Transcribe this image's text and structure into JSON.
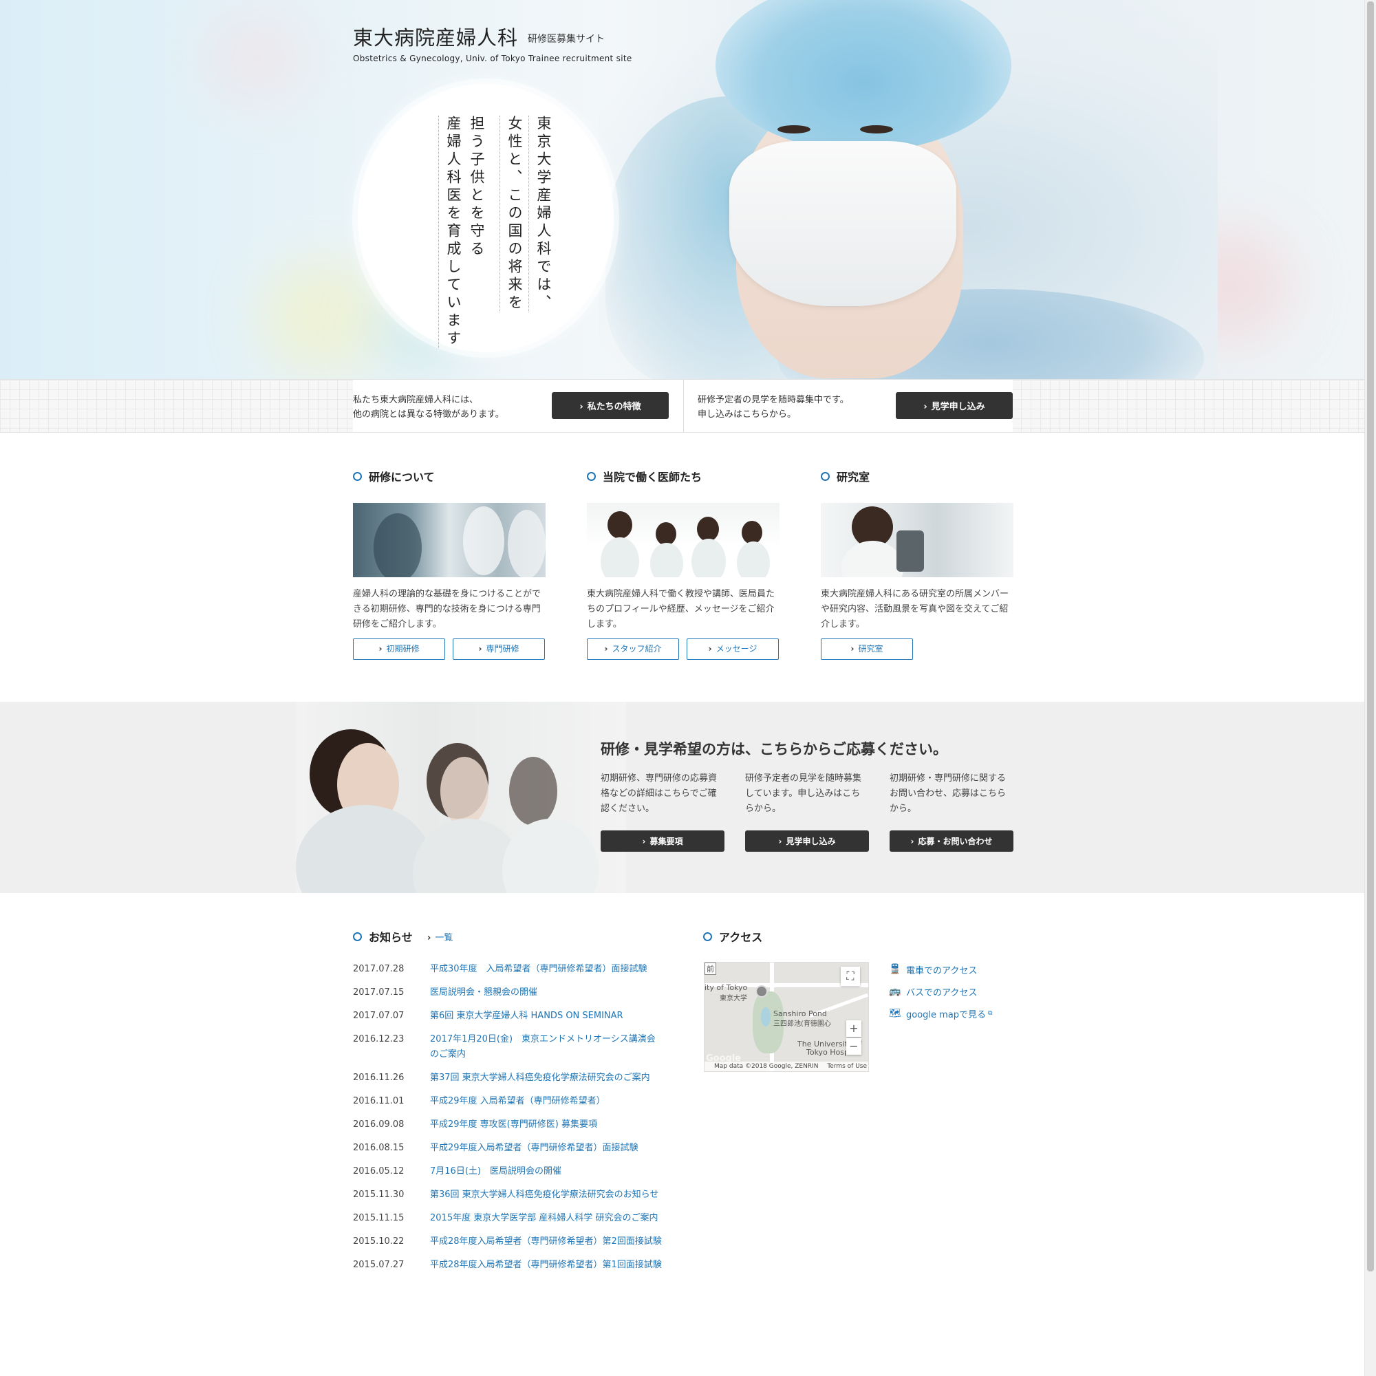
{
  "header": {
    "logo_ja": "東大病院産婦人科",
    "logo_sub": "研修医募集サイト",
    "logo_en": "Obstetrics & Gynecology, Univ. of Tokyo Trainee recruitment site"
  },
  "hero": {
    "lines": [
      "東京大学産婦人科では、",
      "女性と、この国の将来を",
      "担う子供とを守る",
      "産婦人科医を育成しています"
    ]
  },
  "strip": {
    "left_text_1": "私たち東大病院産婦人科には、",
    "left_text_2": "他の病院とは異なる特徴があります。",
    "left_button": "私たちの特徴",
    "right_text_1": "研修予定者の見学を随時募集中です。",
    "right_text_2": "申し込みはこちらから。",
    "right_button": "見学申し込み"
  },
  "features": [
    {
      "title": "研修について",
      "desc": "産婦人科の理論的な基礎を身につけることができる初期研修、専門的な技術を身につける専門研修をご紹介します。",
      "buttons": [
        "初期研修",
        "専門研修"
      ]
    },
    {
      "title": "当院で働く医師たち",
      "desc": "東大病院産婦人科で働く教授や講師、医局員たちのプロフィールや経歴、メッセージをご紹介します。",
      "buttons": [
        "スタッフ紹介",
        "メッセージ"
      ]
    },
    {
      "title": "研究室",
      "desc": "東大病院産婦人科にある研究室の所属メンバーや研究内容、活動風景を写真や図を交えてご紹介します。",
      "buttons": [
        "研究室"
      ]
    }
  ],
  "apply": {
    "heading": "研修・見学希望の方は、こちらからご応募ください。",
    "columns": [
      {
        "text": "初期研修、専門研修の応募資格などの詳細はこちらでご確認ください。",
        "button": "募集要項"
      },
      {
        "text": "研修予定者の見学を随時募集しています。申し込みはこちらから。",
        "button": "見学申し込み"
      },
      {
        "text": "初期研修・専門研修に関するお問い合わせ、応募はこちらから。",
        "button": "応募・お問い合わせ"
      }
    ]
  },
  "news": {
    "title": "お知らせ",
    "all_link": "一覧",
    "items": [
      {
        "date": "2017.07.28",
        "title": "平成30年度　入局希望者（専門研修希望者）面接試験"
      },
      {
        "date": "2017.07.15",
        "title": "医局説明会・懇親会の開催"
      },
      {
        "date": "2017.07.07",
        "title": "第6回 東京大学産婦人科 HANDS ON SEMINAR"
      },
      {
        "date": "2016.12.23",
        "title": "2017年1月20日(金)　東京エンドメトリオーシス講演会のご案内"
      },
      {
        "date": "2016.11.26",
        "title": "第37回 東京大学婦人科癌免疫化学療法研究会のご案内"
      },
      {
        "date": "2016.11.01",
        "title": "平成29年度 入局希望者（専門研修希望者）"
      },
      {
        "date": "2016.09.08",
        "title": "平成29年度 専攻医(専門研修医) 募集要項"
      },
      {
        "date": "2016.08.15",
        "title": "平成29年度入局希望者（専門研修希望者）面接試験"
      },
      {
        "date": "2016.05.12",
        "title": "7月16日(土)　医局説明会の開催"
      },
      {
        "date": "2015.11.30",
        "title": "第36回 東京大学婦人科癌免疫化学療法研究会のお知らせ"
      },
      {
        "date": "2015.11.15",
        "title": "2015年度 東京大学医学部 産科婦人科学 研究会のご案内"
      },
      {
        "date": "2015.10.22",
        "title": "平成28年度入局希望者（専門研修希望者）第2回面接試験"
      },
      {
        "date": "2015.07.27",
        "title": "平成28年度入局希望者（専門研修希望者）第1回面接試験"
      }
    ]
  },
  "access": {
    "title": "アクセス",
    "links": [
      {
        "icon": "train-icon",
        "label": "電車でのアクセス"
      },
      {
        "icon": "bus-icon",
        "label": "バスでのアクセス"
      },
      {
        "icon": "map-icon",
        "label": "google mapで見る"
      }
    ],
    "map": {
      "label_tl": "前",
      "label_univ_en": "ity of Tokyo",
      "label_univ_ja": "東京大学",
      "label_pond_en": "Sanshiro Pond",
      "label_pond_ja": "三四郎池(育徳園心",
      "label_hosp_1": "The University of",
      "label_hosp_2": "Tokyo Hospital",
      "attribution": "Map data ©2018 Google, ZENRIN",
      "terms": "Terms of Use",
      "google": "Google"
    }
  }
}
